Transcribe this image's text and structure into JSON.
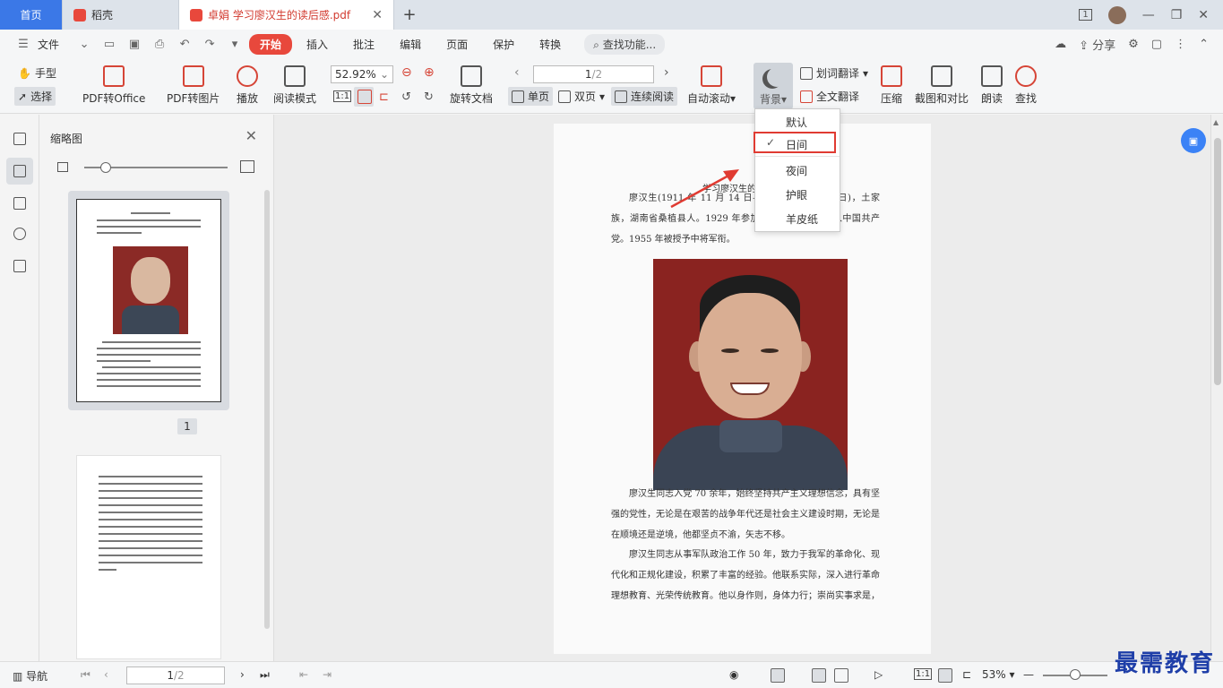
{
  "tabs": {
    "home": "首页",
    "daoke": "稻壳",
    "document": "卓娟 学习廖汉生的读后感.pdf",
    "page_badge": "1"
  },
  "menu": {
    "file": "文件",
    "items": [
      "开始",
      "插入",
      "批注",
      "编辑",
      "页面",
      "保护",
      "转换"
    ],
    "search": "查找功能...",
    "share": "分享"
  },
  "toolbar": {
    "hand": "手型",
    "select": "选择",
    "pdf_to_office": "PDF转Office",
    "pdf_to_image": "PDF转图片",
    "play": "播放",
    "read_mode": "阅读模式",
    "zoom": "52.92%",
    "page_current": "1",
    "page_total": "/2",
    "rotate": "旋转文档",
    "single_page": "单页",
    "double_page": "双页",
    "continuous": "连续阅读",
    "auto_scroll": "自动滚动",
    "background": "背景",
    "word_translate": "划词翻译",
    "full_translate": "全文翻译",
    "compress": "压缩",
    "screenshot_compare": "截图和对比",
    "read_aloud": "朗读",
    "find": "查找",
    "fit_label": "1:1"
  },
  "dropdown": {
    "items": [
      "默认",
      "日间",
      "夜间",
      "护眼",
      "羊皮纸"
    ],
    "selected": "日间"
  },
  "thumbs": {
    "title": "缩略图",
    "page1": "1"
  },
  "document": {
    "title": "学习廖汉生的读后感",
    "para1": "廖汉生(1911 年 11 月 14 日—2006 年 8 月 16 日)，土家族，湖南省桑植县人。1929 年参加革命，1933 年加入中国共产党。1955 年被授予中将军衔。",
    "para2": "廖汉生同志入党 70 余年，始终坚持共产主义理想信念，具有坚强的党性，无论是在艰苦的战争年代还是社会主义建设时期，无论是在顺境还是逆境，他都坚贞不渝，矢志不移。",
    "para3": "廖汉生同志从事军队政治工作 50 年，致力于我军的革命化、现代化和正规化建设，积累了丰富的经验。他联系实际，深入进行革命理想教育、光荣传统教育。他以身作则，身体力行；崇尚实事求是，"
  },
  "statusbar": {
    "nav": "导航",
    "page_current": "1",
    "page_total": "/2",
    "zoom": "53%",
    "fit_label": "1:1"
  },
  "watermark": "最需教育",
  "colors": {
    "accent_red": "#e8483c",
    "home_tab": "#3b78e7",
    "highlight_box": "#e03b32"
  }
}
